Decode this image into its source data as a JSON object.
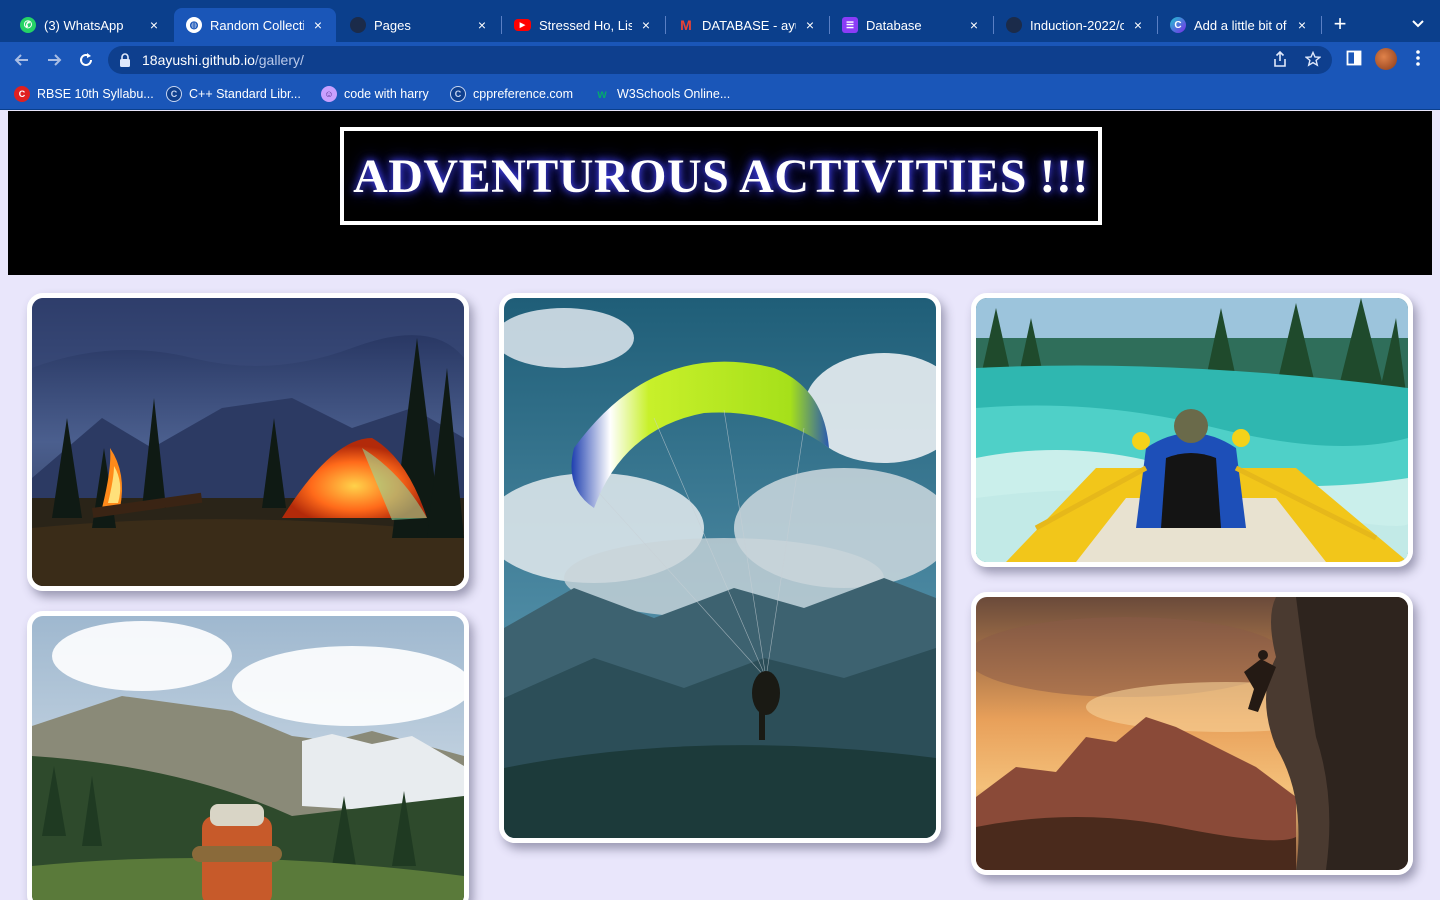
{
  "browser": {
    "tabs": [
      {
        "title": "(3) WhatsApp",
        "icon": "whatsapp-icon",
        "color": "#25d366"
      },
      {
        "title": "Random Collectio",
        "icon": "globe-icon",
        "color": "#ffffff",
        "active": true
      },
      {
        "title": "Pages",
        "icon": "github-icon",
        "color": "#1b2b4a"
      },
      {
        "title": "Stressed Ho, Liste",
        "icon": "youtube-icon",
        "color": "#ff0000"
      },
      {
        "title": "DATABASE - ayus",
        "icon": "gmail-icon",
        "color": "#ea4335"
      },
      {
        "title": "Database",
        "icon": "notion-db-icon",
        "color": "#8b3cf7"
      },
      {
        "title": "Induction-2022/c",
        "icon": "github-icon",
        "color": "#1b2b4a"
      },
      {
        "title": "Add a little bit of",
        "icon": "canva-icon",
        "color": "#1fc3d0"
      }
    ],
    "close_glyph": "×",
    "new_tab_glyph": "+",
    "url_host": "18ayushi.github.io",
    "url_path": "/gallery/",
    "bookmarks": [
      {
        "label": "RBSE 10th Syllabu...",
        "icon": "rbse-icon",
        "color": "#e02020"
      },
      {
        "label": "C++ Standard Libr...",
        "icon": "cppref-icon",
        "color": "#1a56b8"
      },
      {
        "label": "code with harry",
        "icon": "codewithharry-icon",
        "color": "#c9a0ff"
      },
      {
        "label": "cppreference.com",
        "icon": "cppref-icon",
        "color": "#1a56b8"
      },
      {
        "label": "W3Schools Online...",
        "icon": "w3schools-icon",
        "color": "#04aa6d"
      }
    ]
  },
  "page": {
    "title": "ADVENTUROUS ACTIVITIES !!!",
    "gallery": [
      {
        "name": "camping-photo",
        "subject": "camping"
      },
      {
        "name": "paragliding-photo",
        "subject": "paragliding"
      },
      {
        "name": "rafting-photo",
        "subject": "rafting"
      },
      {
        "name": "hiking-photo",
        "subject": "hiking"
      },
      {
        "name": "climbing-photo",
        "subject": "climbing"
      }
    ]
  }
}
